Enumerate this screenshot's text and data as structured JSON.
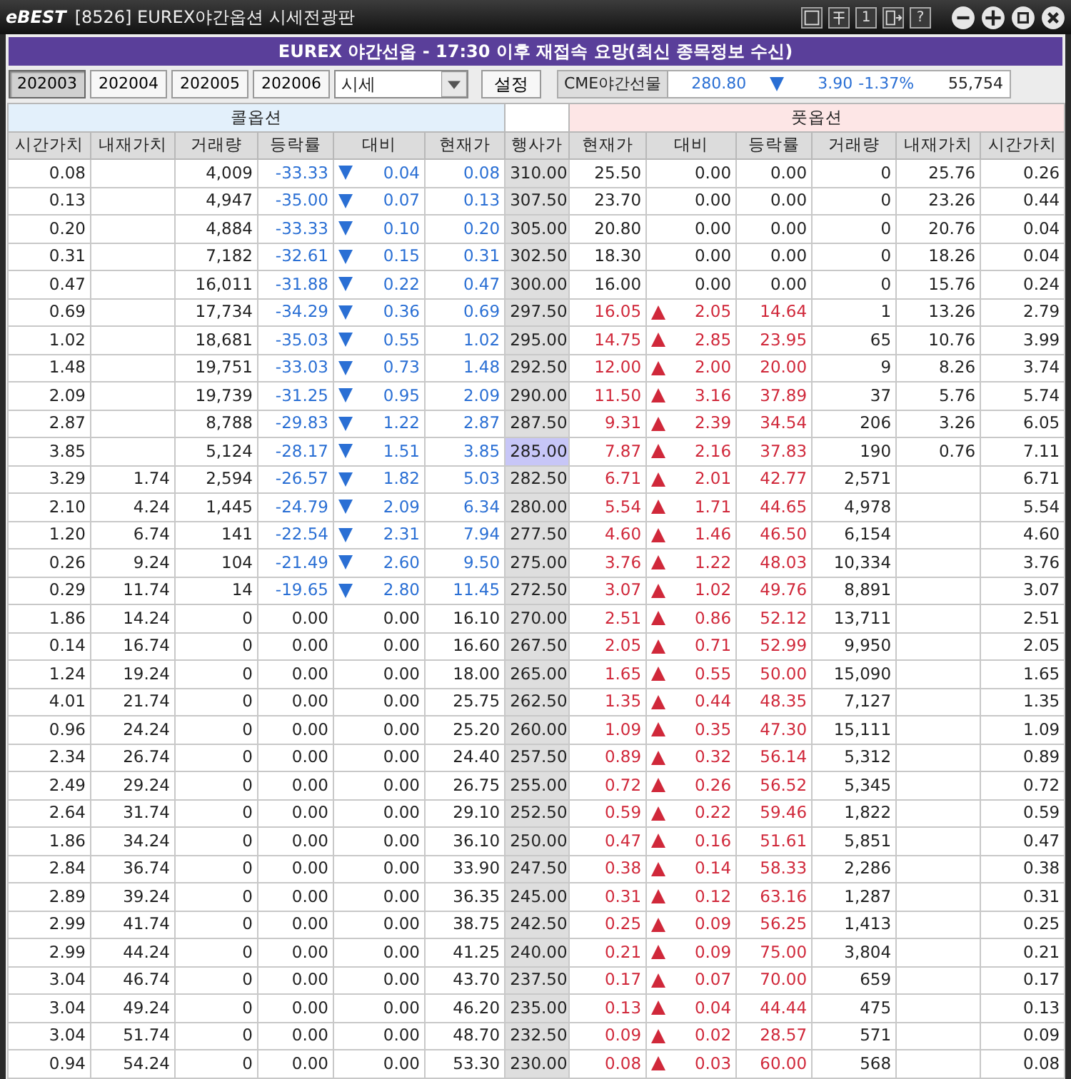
{
  "window": {
    "logo": "eBEST",
    "title": "[8526] EUREX야간옵션 시세전광판"
  },
  "tool_buttons": [
    {
      "kind": "icon"
    },
    {
      "kind": "icon"
    },
    {
      "kind": "text",
      "label": "1"
    },
    {
      "kind": "icon"
    },
    {
      "kind": "text",
      "label": "?"
    }
  ],
  "banner": "EUREX 야간선옵 - 17:30 이후 재접속 요망(최신 종목정보 수신)",
  "months": [
    {
      "label": "202003",
      "selected": true
    },
    {
      "label": "202004",
      "selected": false
    },
    {
      "label": "202005",
      "selected": false
    },
    {
      "label": "202006",
      "selected": false
    }
  ],
  "view_select": {
    "value": "시세"
  },
  "settings_button": "설정",
  "cme": {
    "label": "CME야간선물",
    "price": "280.80",
    "kind": "down",
    "change": "3.90",
    "change_rate": "-1.37%",
    "volume": "55,754"
  },
  "groups": {
    "call": "콜옵션",
    "put": "풋옵션"
  },
  "columns": {
    "call": [
      "시간가치",
      "내재가치",
      "거래량",
      "등락률",
      "대비",
      "현재가"
    ],
    "strike": "행사가",
    "put": [
      "현재가",
      "대비",
      "등락률",
      "거래량",
      "내재가치",
      "시간가치"
    ]
  },
  "rows": [
    {
      "strike": "310.00",
      "selected": false,
      "call": {
        "time_value": "0.08",
        "volume": "4,009",
        "rate": "-33.33",
        "kind": "down",
        "change": "0.04",
        "price": "0.08"
      },
      "put": {
        "price": "25.50",
        "kind": "flat",
        "change": "0.00",
        "rate": "0.00",
        "volume": "0",
        "intrinsic": "25.76",
        "time_value": "0.26"
      }
    },
    {
      "strike": "307.50",
      "selected": false,
      "call": {
        "time_value": "0.13",
        "volume": "4,947",
        "rate": "-35.00",
        "kind": "down",
        "change": "0.07",
        "price": "0.13"
      },
      "put": {
        "price": "23.70",
        "kind": "flat",
        "change": "0.00",
        "rate": "0.00",
        "volume": "0",
        "intrinsic": "23.26",
        "time_value": "0.44"
      }
    },
    {
      "strike": "305.00",
      "selected": false,
      "call": {
        "time_value": "0.20",
        "volume": "4,884",
        "rate": "-33.33",
        "kind": "down",
        "change": "0.10",
        "price": "0.20"
      },
      "put": {
        "price": "20.80",
        "kind": "flat",
        "change": "0.00",
        "rate": "0.00",
        "volume": "0",
        "intrinsic": "20.76",
        "time_value": "0.04"
      }
    },
    {
      "strike": "302.50",
      "selected": false,
      "call": {
        "time_value": "0.31",
        "volume": "7,182",
        "rate": "-32.61",
        "kind": "down",
        "change": "0.15",
        "price": "0.31"
      },
      "put": {
        "price": "18.30",
        "kind": "flat",
        "change": "0.00",
        "rate": "0.00",
        "volume": "0",
        "intrinsic": "18.26",
        "time_value": "0.04"
      }
    },
    {
      "strike": "300.00",
      "selected": false,
      "call": {
        "time_value": "0.47",
        "volume": "16,011",
        "rate": "-31.88",
        "kind": "down",
        "change": "0.22",
        "price": "0.47"
      },
      "put": {
        "price": "16.00",
        "kind": "flat",
        "change": "0.00",
        "rate": "0.00",
        "volume": "0",
        "intrinsic": "15.76",
        "time_value": "0.24"
      }
    },
    {
      "strike": "297.50",
      "selected": false,
      "call": {
        "time_value": "0.69",
        "volume": "17,734",
        "rate": "-34.29",
        "kind": "down",
        "change": "0.36",
        "price": "0.69"
      },
      "put": {
        "price": "16.05",
        "kind": "up",
        "change": "2.05",
        "rate": "14.64",
        "volume": "1",
        "intrinsic": "13.26",
        "time_value": "2.79"
      }
    },
    {
      "strike": "295.00",
      "selected": false,
      "call": {
        "time_value": "1.02",
        "volume": "18,681",
        "rate": "-35.03",
        "kind": "down",
        "change": "0.55",
        "price": "1.02"
      },
      "put": {
        "price": "14.75",
        "kind": "up",
        "change": "2.85",
        "rate": "23.95",
        "volume": "65",
        "intrinsic": "10.76",
        "time_value": "3.99"
      }
    },
    {
      "strike": "292.50",
      "selected": false,
      "call": {
        "time_value": "1.48",
        "volume": "19,751",
        "rate": "-33.03",
        "kind": "down",
        "change": "0.73",
        "price": "1.48"
      },
      "put": {
        "price": "12.00",
        "kind": "up",
        "change": "2.00",
        "rate": "20.00",
        "volume": "9",
        "intrinsic": "8.26",
        "time_value": "3.74"
      }
    },
    {
      "strike": "290.00",
      "selected": false,
      "call": {
        "time_value": "2.09",
        "volume": "19,739",
        "rate": "-31.25",
        "kind": "down",
        "change": "0.95",
        "price": "2.09"
      },
      "put": {
        "price": "11.50",
        "kind": "up",
        "change": "3.16",
        "rate": "37.89",
        "volume": "37",
        "intrinsic": "5.76",
        "time_value": "5.74"
      }
    },
    {
      "strike": "287.50",
      "selected": false,
      "call": {
        "time_value": "2.87",
        "volume": "8,788",
        "rate": "-29.83",
        "kind": "down",
        "change": "1.22",
        "price": "2.87"
      },
      "put": {
        "price": "9.31",
        "kind": "up",
        "change": "2.39",
        "rate": "34.54",
        "volume": "206",
        "intrinsic": "3.26",
        "time_value": "6.05"
      }
    },
    {
      "strike": "285.00",
      "selected": true,
      "call": {
        "time_value": "3.85",
        "volume": "5,124",
        "rate": "-28.17",
        "kind": "down",
        "change": "1.51",
        "price": "3.85"
      },
      "put": {
        "price": "7.87",
        "kind": "up",
        "change": "2.16",
        "rate": "37.83",
        "volume": "190",
        "intrinsic": "0.76",
        "time_value": "7.11"
      }
    },
    {
      "strike": "282.50",
      "selected": false,
      "call": {
        "time_value": "3.29",
        "intrinsic": "1.74",
        "volume": "2,594",
        "rate": "-26.57",
        "kind": "down",
        "change": "1.82",
        "price": "5.03"
      },
      "put": {
        "price": "6.71",
        "kind": "up",
        "change": "2.01",
        "rate": "42.77",
        "volume": "2,571",
        "time_value": "6.71"
      }
    },
    {
      "strike": "280.00",
      "selected": false,
      "call": {
        "time_value": "2.10",
        "intrinsic": "4.24",
        "volume": "1,445",
        "rate": "-24.79",
        "kind": "down",
        "change": "2.09",
        "price": "6.34"
      },
      "put": {
        "price": "5.54",
        "kind": "up",
        "change": "1.71",
        "rate": "44.65",
        "volume": "4,978",
        "time_value": "5.54"
      }
    },
    {
      "strike": "277.50",
      "selected": false,
      "call": {
        "time_value": "1.20",
        "intrinsic": "6.74",
        "volume": "141",
        "rate": "-22.54",
        "kind": "down",
        "change": "2.31",
        "price": "7.94"
      },
      "put": {
        "price": "4.60",
        "kind": "up",
        "change": "1.46",
        "rate": "46.50",
        "volume": "6,154",
        "time_value": "4.60"
      }
    },
    {
      "strike": "275.00",
      "selected": false,
      "call": {
        "time_value": "0.26",
        "intrinsic": "9.24",
        "volume": "104",
        "rate": "-21.49",
        "kind": "down",
        "change": "2.60",
        "price": "9.50"
      },
      "put": {
        "price": "3.76",
        "kind": "up",
        "change": "1.22",
        "rate": "48.03",
        "volume": "10,334",
        "time_value": "3.76"
      }
    },
    {
      "strike": "272.50",
      "selected": false,
      "call": {
        "time_value": "0.29",
        "intrinsic": "11.74",
        "volume": "14",
        "rate": "-19.65",
        "kind": "down",
        "change": "2.80",
        "price": "11.45"
      },
      "put": {
        "price": "3.07",
        "kind": "up",
        "change": "1.02",
        "rate": "49.76",
        "volume": "8,891",
        "time_value": "3.07"
      }
    },
    {
      "strike": "270.00",
      "selected": false,
      "call": {
        "time_value": "1.86",
        "intrinsic": "14.24",
        "volume": "0",
        "rate": "0.00",
        "kind": "flat",
        "change": "0.00",
        "price": "16.10"
      },
      "put": {
        "price": "2.51",
        "kind": "up",
        "change": "0.86",
        "rate": "52.12",
        "volume": "13,711",
        "time_value": "2.51"
      }
    },
    {
      "strike": "267.50",
      "selected": false,
      "call": {
        "time_value": "0.14",
        "intrinsic": "16.74",
        "volume": "0",
        "rate": "0.00",
        "kind": "flat",
        "change": "0.00",
        "price": "16.60"
      },
      "put": {
        "price": "2.05",
        "kind": "up",
        "change": "0.71",
        "rate": "52.99",
        "volume": "9,950",
        "time_value": "2.05"
      }
    },
    {
      "strike": "265.00",
      "selected": false,
      "call": {
        "time_value": "1.24",
        "intrinsic": "19.24",
        "volume": "0",
        "rate": "0.00",
        "kind": "flat",
        "change": "0.00",
        "price": "18.00"
      },
      "put": {
        "price": "1.65",
        "kind": "up",
        "change": "0.55",
        "rate": "50.00",
        "volume": "15,090",
        "time_value": "1.65"
      }
    },
    {
      "strike": "262.50",
      "selected": false,
      "call": {
        "time_value": "4.01",
        "intrinsic": "21.74",
        "volume": "0",
        "rate": "0.00",
        "kind": "flat",
        "change": "0.00",
        "price": "25.75"
      },
      "put": {
        "price": "1.35",
        "kind": "up",
        "change": "0.44",
        "rate": "48.35",
        "volume": "7,127",
        "time_value": "1.35"
      }
    },
    {
      "strike": "260.00",
      "selected": false,
      "call": {
        "time_value": "0.96",
        "intrinsic": "24.24",
        "volume": "0",
        "rate": "0.00",
        "kind": "flat",
        "change": "0.00",
        "price": "25.20"
      },
      "put": {
        "price": "1.09",
        "kind": "up",
        "change": "0.35",
        "rate": "47.30",
        "volume": "15,111",
        "time_value": "1.09"
      }
    },
    {
      "strike": "257.50",
      "selected": false,
      "call": {
        "time_value": "2.34",
        "intrinsic": "26.74",
        "volume": "0",
        "rate": "0.00",
        "kind": "flat",
        "change": "0.00",
        "price": "24.40"
      },
      "put": {
        "price": "0.89",
        "kind": "up",
        "change": "0.32",
        "rate": "56.14",
        "volume": "5,312",
        "time_value": "0.89"
      }
    },
    {
      "strike": "255.00",
      "selected": false,
      "call": {
        "time_value": "2.49",
        "intrinsic": "29.24",
        "volume": "0",
        "rate": "0.00",
        "kind": "flat",
        "change": "0.00",
        "price": "26.75"
      },
      "put": {
        "price": "0.72",
        "kind": "up",
        "change": "0.26",
        "rate": "56.52",
        "volume": "5,345",
        "time_value": "0.72"
      }
    },
    {
      "strike": "252.50",
      "selected": false,
      "call": {
        "time_value": "2.64",
        "intrinsic": "31.74",
        "volume": "0",
        "rate": "0.00",
        "kind": "flat",
        "change": "0.00",
        "price": "29.10"
      },
      "put": {
        "price": "0.59",
        "kind": "up",
        "change": "0.22",
        "rate": "59.46",
        "volume": "1,822",
        "time_value": "0.59"
      }
    },
    {
      "strike": "250.00",
      "selected": false,
      "call": {
        "time_value": "1.86",
        "intrinsic": "34.24",
        "volume": "0",
        "rate": "0.00",
        "kind": "flat",
        "change": "0.00",
        "price": "36.10"
      },
      "put": {
        "price": "0.47",
        "kind": "up",
        "change": "0.16",
        "rate": "51.61",
        "volume": "5,851",
        "time_value": "0.47"
      }
    },
    {
      "strike": "247.50",
      "selected": false,
      "call": {
        "time_value": "2.84",
        "intrinsic": "36.74",
        "volume": "0",
        "rate": "0.00",
        "kind": "flat",
        "change": "0.00",
        "price": "33.90"
      },
      "put": {
        "price": "0.38",
        "kind": "up",
        "change": "0.14",
        "rate": "58.33",
        "volume": "2,286",
        "time_value": "0.38"
      }
    },
    {
      "strike": "245.00",
      "selected": false,
      "call": {
        "time_value": "2.89",
        "intrinsic": "39.24",
        "volume": "0",
        "rate": "0.00",
        "kind": "flat",
        "change": "0.00",
        "price": "36.35"
      },
      "put": {
        "price": "0.31",
        "kind": "up",
        "change": "0.12",
        "rate": "63.16",
        "volume": "1,287",
        "time_value": "0.31"
      }
    },
    {
      "strike": "242.50",
      "selected": false,
      "call": {
        "time_value": "2.99",
        "intrinsic": "41.74",
        "volume": "0",
        "rate": "0.00",
        "kind": "flat",
        "change": "0.00",
        "price": "38.75"
      },
      "put": {
        "price": "0.25",
        "kind": "up",
        "change": "0.09",
        "rate": "56.25",
        "volume": "1,413",
        "time_value": "0.25"
      }
    },
    {
      "strike": "240.00",
      "selected": false,
      "call": {
        "time_value": "2.99",
        "intrinsic": "44.24",
        "volume": "0",
        "rate": "0.00",
        "kind": "flat",
        "change": "0.00",
        "price": "41.25"
      },
      "put": {
        "price": "0.21",
        "kind": "up",
        "change": "0.09",
        "rate": "75.00",
        "volume": "3,804",
        "time_value": "0.21"
      }
    },
    {
      "strike": "237.50",
      "selected": false,
      "call": {
        "time_value": "3.04",
        "intrinsic": "46.74",
        "volume": "0",
        "rate": "0.00",
        "kind": "flat",
        "change": "0.00",
        "price": "43.70"
      },
      "put": {
        "price": "0.17",
        "kind": "up",
        "change": "0.07",
        "rate": "70.00",
        "volume": "659",
        "time_value": "0.17"
      }
    },
    {
      "strike": "235.00",
      "selected": false,
      "call": {
        "time_value": "3.04",
        "intrinsic": "49.24",
        "volume": "0",
        "rate": "0.00",
        "kind": "flat",
        "change": "0.00",
        "price": "46.20"
      },
      "put": {
        "price": "0.13",
        "kind": "up",
        "change": "0.04",
        "rate": "44.44",
        "volume": "475",
        "time_value": "0.13"
      }
    },
    {
      "strike": "232.50",
      "selected": false,
      "call": {
        "time_value": "3.04",
        "intrinsic": "51.74",
        "volume": "0",
        "rate": "0.00",
        "kind": "flat",
        "change": "0.00",
        "price": "48.70"
      },
      "put": {
        "price": "0.09",
        "kind": "up",
        "change": "0.02",
        "rate": "28.57",
        "volume": "571",
        "time_value": "0.09"
      }
    },
    {
      "strike": "230.00",
      "selected": false,
      "call": {
        "time_value": "0.94",
        "intrinsic": "54.24",
        "volume": "0",
        "rate": "0.00",
        "kind": "flat",
        "change": "0.00",
        "price": "53.30"
      },
      "put": {
        "price": "0.08",
        "kind": "up",
        "change": "0.03",
        "rate": "60.00",
        "volume": "568",
        "time_value": "0.08"
      }
    }
  ]
}
